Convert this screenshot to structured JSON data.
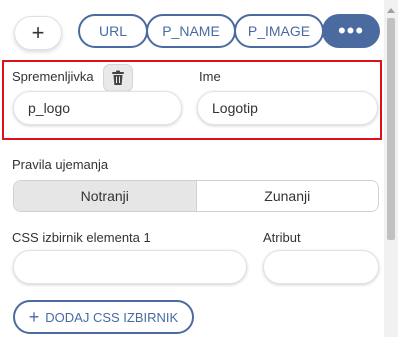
{
  "toolbar": {
    "add_symbol": "+",
    "tags": [
      "URL",
      "P_NAME",
      "P_IMAGE"
    ],
    "more_symbol": "•••"
  },
  "variable": {
    "variable_label": "Spremenljivka",
    "variable_value": "p_logo",
    "name_label": "Ime",
    "name_value": "Logotip"
  },
  "rules": {
    "label": "Pravila ujemanja",
    "options": [
      "Notranji",
      "Zunanji"
    ],
    "selected": "Notranji"
  },
  "css": {
    "selector_label": "CSS izbirnik elementa 1",
    "attribute_label": "Atribut",
    "selector_value": "",
    "attribute_value": "",
    "add_button_label": "DODAJ CSS IZBIRNIK",
    "add_symbol": "+"
  },
  "colors": {
    "accent": "#4a6aa0",
    "highlight": "#e0101a"
  }
}
